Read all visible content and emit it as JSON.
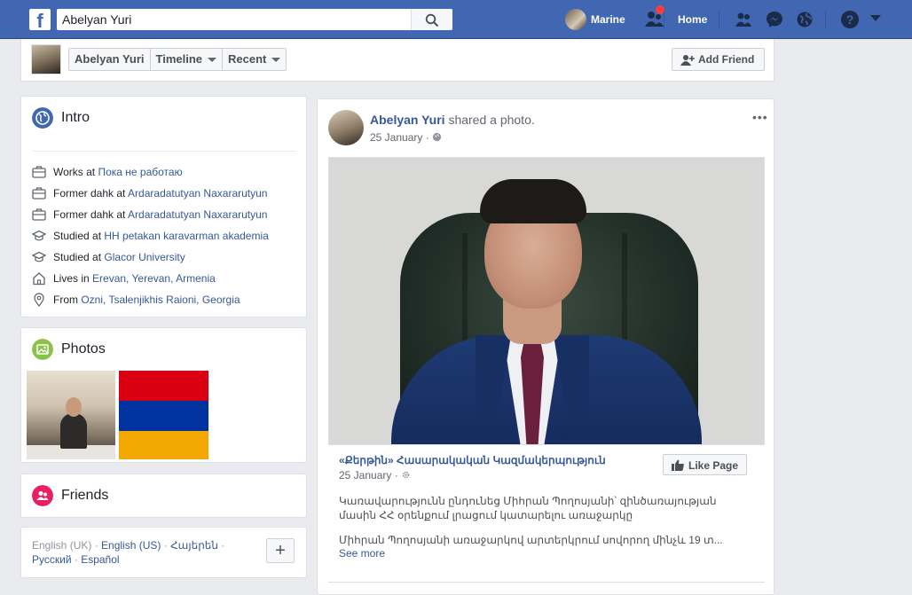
{
  "topbar": {
    "logo": "f",
    "search_value": "Abelyan Yuri",
    "search_placeholder": "Search",
    "user_name": "Marine",
    "home_label": "Home",
    "icons": [
      "friend-requests-icon",
      "messenger-icon",
      "notifications-globe-icon",
      "help-icon",
      "account-menu-caret-icon"
    ],
    "colors": {
      "bar": "#4267b2",
      "badge": "#fa3e3e"
    }
  },
  "profile_bar": {
    "tabs": [
      {
        "label": "Abelyan Yuri"
      },
      {
        "label": "Timeline"
      },
      {
        "label": "Recent"
      }
    ],
    "add_friend_label": "Add Friend"
  },
  "intro": {
    "title": "Intro",
    "rows": [
      {
        "icon": "briefcase-icon",
        "prefix": "Works at",
        "link": "Пока не работаю"
      },
      {
        "icon": "briefcase-icon",
        "prefix": "Former dahk at",
        "link": "Ardaradatutyan Naxararutyun"
      },
      {
        "icon": "briefcase-icon",
        "prefix": "Former dahk at",
        "link": "Ardaradatutyan Naxararutyun"
      },
      {
        "icon": "graduation-cap-icon",
        "prefix": "Studied at",
        "link": "HH petakan karavarman akademia"
      },
      {
        "icon": "graduation-cap-icon",
        "prefix": "Studied at",
        "link": "Glacor University"
      },
      {
        "icon": "home-icon",
        "prefix": "Lives in",
        "link": "Erevan, Yerevan, Armenia"
      },
      {
        "icon": "location-pin-icon",
        "prefix": "From",
        "link": "Ozni, Tsalenjikhis Raioni, Georgia"
      }
    ]
  },
  "photos": {
    "title": "Photos"
  },
  "friends": {
    "title": "Friends"
  },
  "languages": {
    "items": [
      {
        "label": "English (UK)",
        "active": false
      },
      {
        "label": "English (US)",
        "active": true
      },
      {
        "label": "Հայերեն",
        "active": true
      },
      {
        "label": "Русский",
        "active": true
      },
      {
        "label": "Español",
        "active": true
      }
    ],
    "add_label": "+"
  },
  "post": {
    "author": "Abelyan Yuri",
    "action": " shared a photo.",
    "date": "25 January",
    "menu": "•••",
    "shared_title": "«Քերթին» Հասարակական Կազմակերպություն",
    "shared_date": "25 January",
    "like_page_label": "Like Page",
    "body_1": "Կառավարությունն ընդունեց Միհրան Պողոսյանի՝ զինծառայության մասին ՀՀ օրենքում լրացում կատարելու առաջարկը",
    "body_2": "Միհրան Պողոսյանի առաջարկով արտերկրում սովորող մինչև 19 տ...",
    "see_more": "See more"
  }
}
